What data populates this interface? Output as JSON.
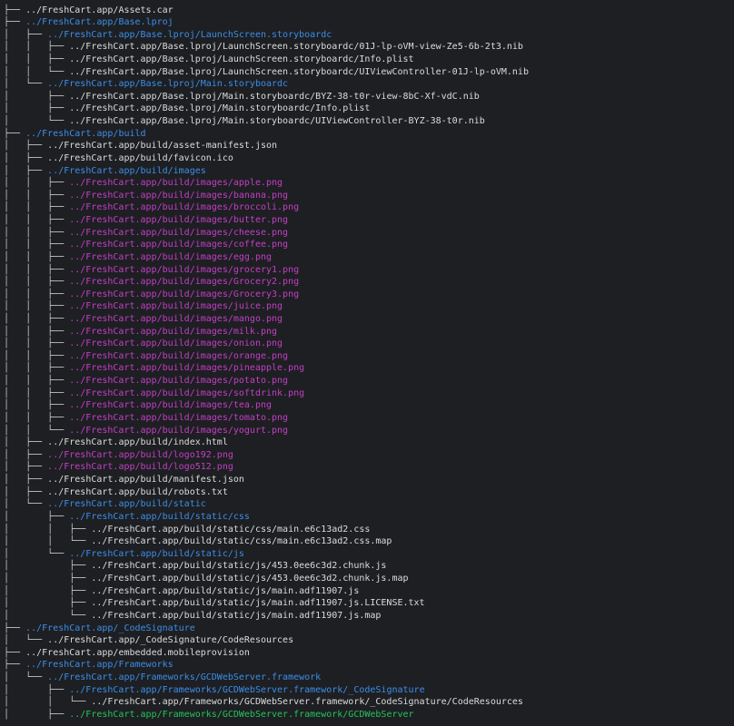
{
  "colors": {
    "background": "#1e1f22",
    "file": "#dcdcdc",
    "dir": "#3b8eea",
    "image": "#c33fc7",
    "exec": "#23c45c",
    "tree_lines": "#c8c8c8"
  },
  "rows": [
    {
      "prefix": "├── ",
      "path": "../FreshCart.app/Assets.car",
      "type": "file"
    },
    {
      "prefix": "├── ",
      "path": "../FreshCart.app/Base.lproj",
      "type": "dir"
    },
    {
      "prefix": "│   ├── ",
      "path": "../FreshCart.app/Base.lproj/LaunchScreen.storyboardc",
      "type": "dir"
    },
    {
      "prefix": "│   │   ├── ",
      "path": "../FreshCart.app/Base.lproj/LaunchScreen.storyboardc/01J-lp-oVM-view-Ze5-6b-2t3.nib",
      "type": "file"
    },
    {
      "prefix": "│   │   ├── ",
      "path": "../FreshCart.app/Base.lproj/LaunchScreen.storyboardc/Info.plist",
      "type": "file"
    },
    {
      "prefix": "│   │   └── ",
      "path": "../FreshCart.app/Base.lproj/LaunchScreen.storyboardc/UIViewController-01J-lp-oVM.nib",
      "type": "file"
    },
    {
      "prefix": "│   └── ",
      "path": "../FreshCart.app/Base.lproj/Main.storyboardc",
      "type": "dir"
    },
    {
      "prefix": "│       ├── ",
      "path": "../FreshCart.app/Base.lproj/Main.storyboardc/BYZ-38-t0r-view-8bC-Xf-vdC.nib",
      "type": "file"
    },
    {
      "prefix": "│       ├── ",
      "path": "../FreshCart.app/Base.lproj/Main.storyboardc/Info.plist",
      "type": "file"
    },
    {
      "prefix": "│       └── ",
      "path": "../FreshCart.app/Base.lproj/Main.storyboardc/UIViewController-BYZ-38-t0r.nib",
      "type": "file"
    },
    {
      "prefix": "├── ",
      "path": "../FreshCart.app/build",
      "type": "dir"
    },
    {
      "prefix": "│   ├── ",
      "path": "../FreshCart.app/build/asset-manifest.json",
      "type": "file"
    },
    {
      "prefix": "│   ├── ",
      "path": "../FreshCart.app/build/favicon.ico",
      "type": "file"
    },
    {
      "prefix": "│   ├── ",
      "path": "../FreshCart.app/build/images",
      "type": "dir"
    },
    {
      "prefix": "│   │   ├── ",
      "path": "../FreshCart.app/build/images/apple.png",
      "type": "image"
    },
    {
      "prefix": "│   │   ├── ",
      "path": "../FreshCart.app/build/images/banana.png",
      "type": "image"
    },
    {
      "prefix": "│   │   ├── ",
      "path": "../FreshCart.app/build/images/broccoli.png",
      "type": "image"
    },
    {
      "prefix": "│   │   ├── ",
      "path": "../FreshCart.app/build/images/butter.png",
      "type": "image"
    },
    {
      "prefix": "│   │   ├── ",
      "path": "../FreshCart.app/build/images/cheese.png",
      "type": "image"
    },
    {
      "prefix": "│   │   ├── ",
      "path": "../FreshCart.app/build/images/coffee.png",
      "type": "image"
    },
    {
      "prefix": "│   │   ├── ",
      "path": "../FreshCart.app/build/images/egg.png",
      "type": "image"
    },
    {
      "prefix": "│   │   ├── ",
      "path": "../FreshCart.app/build/images/grocery1.png",
      "type": "image"
    },
    {
      "prefix": "│   │   ├── ",
      "path": "../FreshCart.app/build/images/Grocery2.png",
      "type": "image"
    },
    {
      "prefix": "│   │   ├── ",
      "path": "../FreshCart.app/build/images/Grocery3.png",
      "type": "image"
    },
    {
      "prefix": "│   │   ├── ",
      "path": "../FreshCart.app/build/images/juice.png",
      "type": "image"
    },
    {
      "prefix": "│   │   ├── ",
      "path": "../FreshCart.app/build/images/mango.png",
      "type": "image"
    },
    {
      "prefix": "│   │   ├── ",
      "path": "../FreshCart.app/build/images/milk.png",
      "type": "image"
    },
    {
      "prefix": "│   │   ├── ",
      "path": "../FreshCart.app/build/images/onion.png",
      "type": "image"
    },
    {
      "prefix": "│   │   ├── ",
      "path": "../FreshCart.app/build/images/orange.png",
      "type": "image"
    },
    {
      "prefix": "│   │   ├── ",
      "path": "../FreshCart.app/build/images/pineapple.png",
      "type": "image"
    },
    {
      "prefix": "│   │   ├── ",
      "path": "../FreshCart.app/build/images/potato.png",
      "type": "image"
    },
    {
      "prefix": "│   │   ├── ",
      "path": "../FreshCart.app/build/images/softdrink.png",
      "type": "image"
    },
    {
      "prefix": "│   │   ├── ",
      "path": "../FreshCart.app/build/images/tea.png",
      "type": "image"
    },
    {
      "prefix": "│   │   ├── ",
      "path": "../FreshCart.app/build/images/tomato.png",
      "type": "image"
    },
    {
      "prefix": "│   │   └── ",
      "path": "../FreshCart.app/build/images/yogurt.png",
      "type": "image"
    },
    {
      "prefix": "│   ├── ",
      "path": "../FreshCart.app/build/index.html",
      "type": "file"
    },
    {
      "prefix": "│   ├── ",
      "path": "../FreshCart.app/build/logo192.png",
      "type": "image"
    },
    {
      "prefix": "│   ├── ",
      "path": "../FreshCart.app/build/logo512.png",
      "type": "image"
    },
    {
      "prefix": "│   ├── ",
      "path": "../FreshCart.app/build/manifest.json",
      "type": "file"
    },
    {
      "prefix": "│   ├── ",
      "path": "../FreshCart.app/build/robots.txt",
      "type": "file"
    },
    {
      "prefix": "│   └── ",
      "path": "../FreshCart.app/build/static",
      "type": "dir"
    },
    {
      "prefix": "│       ├── ",
      "path": "../FreshCart.app/build/static/css",
      "type": "dir"
    },
    {
      "prefix": "│       │   ├── ",
      "path": "../FreshCart.app/build/static/css/main.e6c13ad2.css",
      "type": "file"
    },
    {
      "prefix": "│       │   └── ",
      "path": "../FreshCart.app/build/static/css/main.e6c13ad2.css.map",
      "type": "file"
    },
    {
      "prefix": "│       └── ",
      "path": "../FreshCart.app/build/static/js",
      "type": "dir"
    },
    {
      "prefix": "│           ├── ",
      "path": "../FreshCart.app/build/static/js/453.0ee6c3d2.chunk.js",
      "type": "file"
    },
    {
      "prefix": "│           ├── ",
      "path": "../FreshCart.app/build/static/js/453.0ee6c3d2.chunk.js.map",
      "type": "file"
    },
    {
      "prefix": "│           ├── ",
      "path": "../FreshCart.app/build/static/js/main.adf11907.js",
      "type": "file"
    },
    {
      "prefix": "│           ├── ",
      "path": "../FreshCart.app/build/static/js/main.adf11907.js.LICENSE.txt",
      "type": "file"
    },
    {
      "prefix": "│           └── ",
      "path": "../FreshCart.app/build/static/js/main.adf11907.js.map",
      "type": "file"
    },
    {
      "prefix": "├── ",
      "path": "../FreshCart.app/_CodeSignature",
      "type": "dir"
    },
    {
      "prefix": "│   └── ",
      "path": "../FreshCart.app/_CodeSignature/CodeResources",
      "type": "file"
    },
    {
      "prefix": "├── ",
      "path": "../FreshCart.app/embedded.mobileprovision",
      "type": "file"
    },
    {
      "prefix": "├── ",
      "path": "../FreshCart.app/Frameworks",
      "type": "dir"
    },
    {
      "prefix": "│   └── ",
      "path": "../FreshCart.app/Frameworks/GCDWebServer.framework",
      "type": "dir"
    },
    {
      "prefix": "│       ├── ",
      "path": "../FreshCart.app/Frameworks/GCDWebServer.framework/_CodeSignature",
      "type": "dir"
    },
    {
      "prefix": "│       │   └── ",
      "path": "../FreshCart.app/Frameworks/GCDWebServer.framework/_CodeSignature/CodeResources",
      "type": "file"
    },
    {
      "prefix": "│       ├── ",
      "path": "../FreshCart.app/Frameworks/GCDWebServer.framework/GCDWebServer",
      "type": "exec"
    }
  ]
}
